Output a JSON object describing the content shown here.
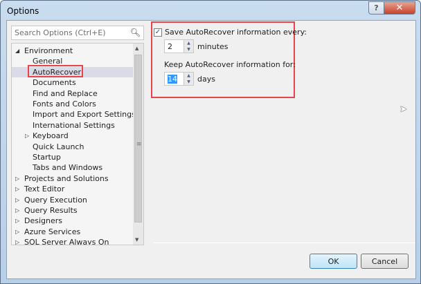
{
  "window": {
    "title": "Options",
    "help": "?",
    "close": "✕"
  },
  "search": {
    "placeholder": "Search Options (Ctrl+E)"
  },
  "tree": [
    {
      "label": "Environment",
      "level": 0,
      "expander": "expanded"
    },
    {
      "label": "General",
      "level": 1
    },
    {
      "label": "AutoRecover",
      "level": 1,
      "selected": true
    },
    {
      "label": "Documents",
      "level": 1
    },
    {
      "label": "Find and Replace",
      "level": 1
    },
    {
      "label": "Fonts and Colors",
      "level": 1
    },
    {
      "label": "Import and Export Settings",
      "level": 1
    },
    {
      "label": "International Settings",
      "level": 1
    },
    {
      "label": "Keyboard",
      "level": 1,
      "expander": "collapsed"
    },
    {
      "label": "Quick Launch",
      "level": 1
    },
    {
      "label": "Startup",
      "level": 1
    },
    {
      "label": "Tabs and Windows",
      "level": 1
    },
    {
      "label": "Projects and Solutions",
      "level": 0,
      "expander": "collapsed"
    },
    {
      "label": "Text Editor",
      "level": 0,
      "expander": "collapsed"
    },
    {
      "label": "Query Execution",
      "level": 0,
      "expander": "collapsed"
    },
    {
      "label": "Query Results",
      "level": 0,
      "expander": "collapsed"
    },
    {
      "label": "Designers",
      "level": 0,
      "expander": "collapsed"
    },
    {
      "label": "Azure Services",
      "level": 0,
      "expander": "collapsed"
    },
    {
      "label": "SQL Server Always On",
      "level": 0,
      "expander": "collapsed"
    }
  ],
  "autorecover": {
    "save_label": "Save AutoRecover information every:",
    "save_checked": true,
    "minutes_value": "2",
    "minutes_label": "minutes",
    "keep_label": "Keep AutoRecover information for:",
    "days_value": "14",
    "days_label": "days"
  },
  "buttons": {
    "ok": "OK",
    "cancel": "Cancel"
  },
  "colors": {
    "highlight": "#e8424a",
    "selection": "#dadbe6"
  }
}
